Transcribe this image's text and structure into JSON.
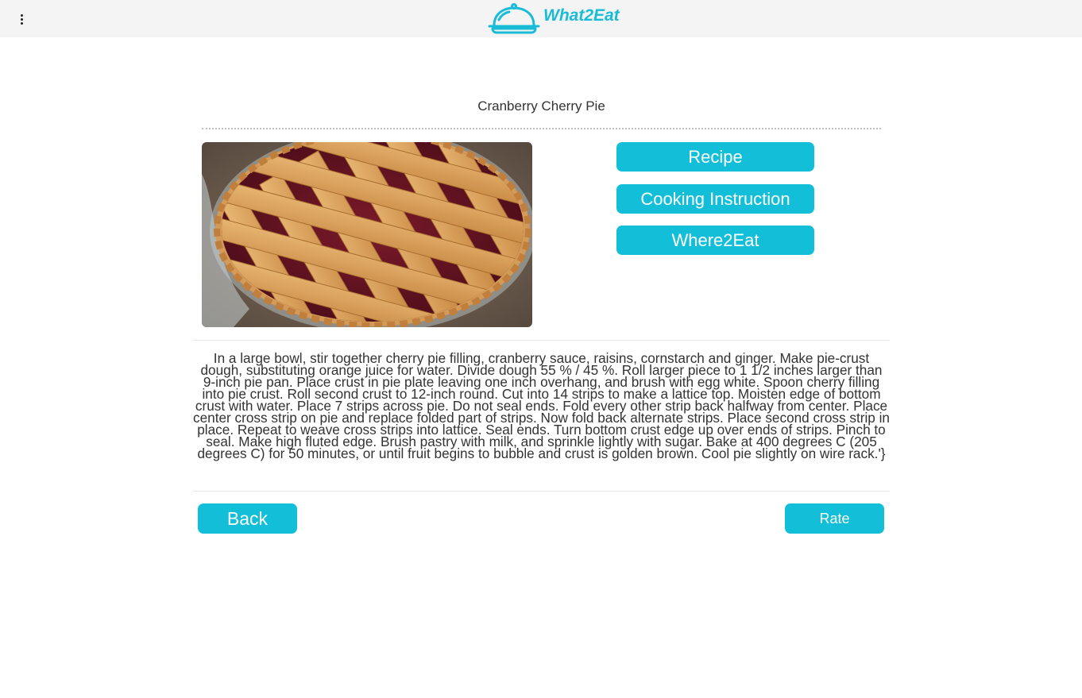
{
  "app": {
    "name": "What2Eat",
    "brand_color": "#19bcd6",
    "menu_icon": "more-vertical-icon",
    "logo_icon": "serving-cloche-icon"
  },
  "recipe": {
    "title": "Cranberry Cherry Pie",
    "image_alt": "Cranberry Cherry Pie",
    "instructions": "In a large bowl, stir together cherry pie filling, cranberry sauce, raisins, cornstarch and ginger. Make pie-crust dough, substituting orange juice for water. Divide dough 55 % / 45 %. Roll larger piece to 1 1/2 inches larger than 9-inch pie pan. Place crust in pie plate leaving one inch overhang, and brush with egg white. Spoon cherry filling into pie crust. Roll second crust to 12-inch round. Cut into 14 strips to make a lattice top. Moisten edge of bottom crust with water. Place 7 strips across pie. Do not seal ends. Fold every other strip back halfway from center. Place center cross strip on pie and replace folded part of strips. Now fold back alternate strips. Place second cross strip in place. Repeat to weave cross strips into lattice. Seal ends. Turn bottom crust edge up over ends of strips. Pinch to seal. Make high fluted edge. Brush pastry with milk, and sprinkle lightly with sugar. Bake at 400 degrees C (205 degrees C) for 50 minutes, or until fruit begins to bubble and crust is golden brown. Cool pie slightly on wire rack.'}"
  },
  "actions": {
    "recipe_label": "Recipe",
    "cooking_instruction_label": "Cooking Instruction",
    "where2eat_label": "Where2Eat",
    "back_label": "Back",
    "rate_label": "Rate",
    "button_color": "#13bfd8"
  }
}
